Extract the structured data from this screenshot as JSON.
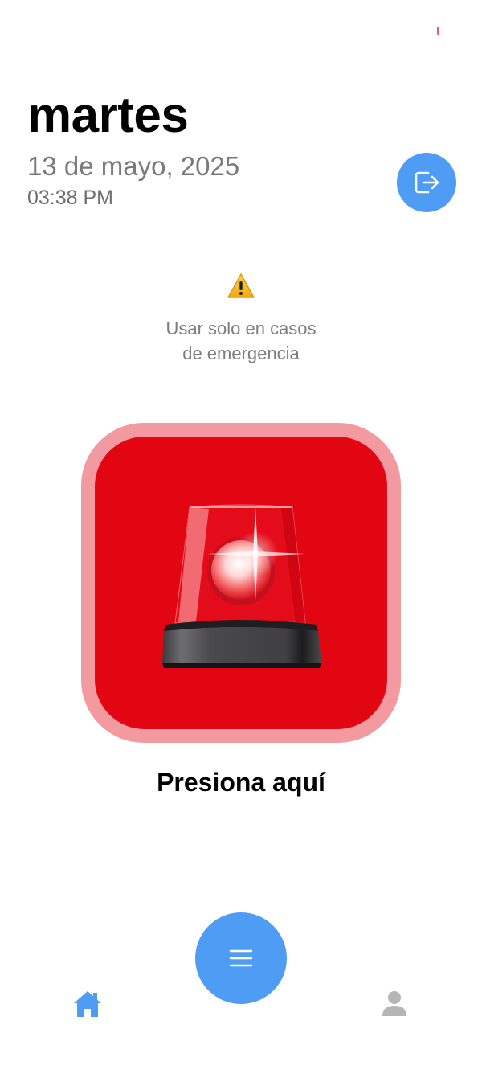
{
  "header": {
    "day": "martes",
    "date": "13 de mayo, 2025",
    "time": "03:38 PM"
  },
  "warning": {
    "icon": "warning-icon",
    "line1": "Usar solo en casos",
    "line2": "de emergencia"
  },
  "panic_button": {
    "icon": "siren-icon",
    "label": "Presiona aquí"
  },
  "nav": {
    "home_icon": "home-icon",
    "menu_icon": "menu-icon",
    "profile_icon": "profile-icon",
    "logout_icon": "logout-icon"
  },
  "colors": {
    "accent": "#4f9cf5",
    "panic_red": "#e20613",
    "panic_border": "#f39aa0",
    "inactive_gray": "#b5b5b5"
  }
}
